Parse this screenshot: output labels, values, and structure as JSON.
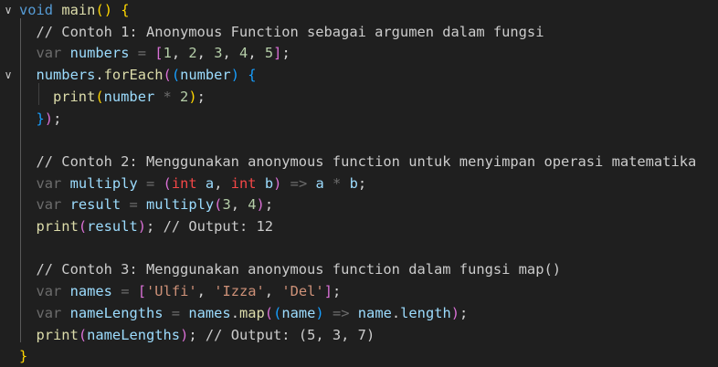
{
  "editor": {
    "lines": [
      {
        "fold": "chevron-down",
        "indent": 0,
        "tokens": [
          {
            "t": "void",
            "c": "t-kw"
          },
          {
            "t": " ",
            "c": ""
          },
          {
            "t": "main",
            "c": "t-fn"
          },
          {
            "t": "()",
            "c": "b-gold"
          },
          {
            "t": " ",
            "c": ""
          },
          {
            "t": "{",
            "c": "b-gold"
          }
        ]
      },
      {
        "fold": "",
        "indent": 1,
        "tokens": [
          {
            "t": "// Contoh 1: Anonymous Function sebagai argumen dalam fungsi",
            "c": "t-cmt"
          }
        ]
      },
      {
        "fold": "",
        "indent": 1,
        "tokens": [
          {
            "t": "var",
            "c": "t-var-kw"
          },
          {
            "t": " ",
            "c": ""
          },
          {
            "t": "numbers",
            "c": "t-var"
          },
          {
            "t": " = ",
            "c": "t-dim"
          },
          {
            "t": "[",
            "c": "b-pink"
          },
          {
            "t": "1",
            "c": "t-num"
          },
          {
            "t": ", ",
            "c": "t-punc"
          },
          {
            "t": "2",
            "c": "t-num"
          },
          {
            "t": ", ",
            "c": "t-punc"
          },
          {
            "t": "3",
            "c": "t-num"
          },
          {
            "t": ", ",
            "c": "t-punc"
          },
          {
            "t": "4",
            "c": "t-num"
          },
          {
            "t": ", ",
            "c": "t-punc"
          },
          {
            "t": "5",
            "c": "t-num"
          },
          {
            "t": "]",
            "c": "b-pink"
          },
          {
            "t": ";",
            "c": "t-punc"
          }
        ]
      },
      {
        "fold": "chevron-down",
        "indent": 1,
        "tokens": [
          {
            "t": "numbers",
            "c": "t-var"
          },
          {
            "t": ".",
            "c": "t-punc"
          },
          {
            "t": "forEach",
            "c": "t-fn"
          },
          {
            "t": "(",
            "c": "b-pink"
          },
          {
            "t": "(",
            "c": "b-blue"
          },
          {
            "t": "number",
            "c": "t-var"
          },
          {
            "t": ")",
            "c": "b-blue"
          },
          {
            "t": " ",
            "c": ""
          },
          {
            "t": "{",
            "c": "b-blue"
          }
        ]
      },
      {
        "fold": "",
        "indent": 2,
        "tokens": [
          {
            "t": "print",
            "c": "t-fn"
          },
          {
            "t": "(",
            "c": "b-gold"
          },
          {
            "t": "number",
            "c": "t-var"
          },
          {
            "t": " * ",
            "c": "t-dim"
          },
          {
            "t": "2",
            "c": "t-num"
          },
          {
            "t": ")",
            "c": "b-gold"
          },
          {
            "t": ";",
            "c": "t-punc"
          }
        ]
      },
      {
        "fold": "",
        "indent": 1,
        "tokens": [
          {
            "t": "}",
            "c": "b-blue"
          },
          {
            "t": ")",
            "c": "b-pink"
          },
          {
            "t": ";",
            "c": "t-punc"
          }
        ]
      },
      {
        "fold": "",
        "indent": 0,
        "tokens": []
      },
      {
        "fold": "",
        "indent": 1,
        "tokens": [
          {
            "t": "// Contoh 2: Menggunakan anonymous function untuk menyimpan operasi matematika",
            "c": "t-cmt"
          }
        ]
      },
      {
        "fold": "",
        "indent": 1,
        "tokens": [
          {
            "t": "var",
            "c": "t-var-kw"
          },
          {
            "t": " ",
            "c": ""
          },
          {
            "t": "multiply",
            "c": "t-var"
          },
          {
            "t": " = ",
            "c": "t-dim"
          },
          {
            "t": "(",
            "c": "b-pink"
          },
          {
            "t": "int",
            "c": "t-type"
          },
          {
            "t": " ",
            "c": ""
          },
          {
            "t": "a",
            "c": "t-var"
          },
          {
            "t": ", ",
            "c": "t-punc"
          },
          {
            "t": "int",
            "c": "t-type"
          },
          {
            "t": " ",
            "c": ""
          },
          {
            "t": "b",
            "c": "t-var"
          },
          {
            "t": ")",
            "c": "b-pink"
          },
          {
            "t": " => ",
            "c": "t-dim"
          },
          {
            "t": "a",
            "c": "t-var"
          },
          {
            "t": " * ",
            "c": "t-dim"
          },
          {
            "t": "b",
            "c": "t-var"
          },
          {
            "t": ";",
            "c": "t-punc"
          }
        ]
      },
      {
        "fold": "",
        "indent": 1,
        "tokens": [
          {
            "t": "var",
            "c": "t-var-kw"
          },
          {
            "t": " ",
            "c": ""
          },
          {
            "t": "result",
            "c": "t-var"
          },
          {
            "t": " = ",
            "c": "t-dim"
          },
          {
            "t": "multiply",
            "c": "t-var"
          },
          {
            "t": "(",
            "c": "b-pink"
          },
          {
            "t": "3",
            "c": "t-num"
          },
          {
            "t": ", ",
            "c": "t-punc"
          },
          {
            "t": "4",
            "c": "t-num"
          },
          {
            "t": ")",
            "c": "b-pink"
          },
          {
            "t": ";",
            "c": "t-punc"
          }
        ]
      },
      {
        "fold": "",
        "indent": 1,
        "tokens": [
          {
            "t": "print",
            "c": "t-fn"
          },
          {
            "t": "(",
            "c": "b-pink"
          },
          {
            "t": "result",
            "c": "t-var"
          },
          {
            "t": ")",
            "c": "b-pink"
          },
          {
            "t": "; ",
            "c": "t-punc"
          },
          {
            "t": "// Output: 12",
            "c": "t-cmt"
          }
        ]
      },
      {
        "fold": "",
        "indent": 0,
        "tokens": []
      },
      {
        "fold": "",
        "indent": 1,
        "tokens": [
          {
            "t": "// Contoh 3: Menggunakan anonymous function dalam fungsi map()",
            "c": "t-cmt"
          }
        ]
      },
      {
        "fold": "",
        "indent": 1,
        "tokens": [
          {
            "t": "var",
            "c": "t-var-kw"
          },
          {
            "t": " ",
            "c": ""
          },
          {
            "t": "names",
            "c": "t-var"
          },
          {
            "t": " = ",
            "c": "t-dim"
          },
          {
            "t": "[",
            "c": "b-pink"
          },
          {
            "t": "'Ulfi'",
            "c": "t-str"
          },
          {
            "t": ", ",
            "c": "t-punc"
          },
          {
            "t": "'Izza'",
            "c": "t-str"
          },
          {
            "t": ", ",
            "c": "t-punc"
          },
          {
            "t": "'Del'",
            "c": "t-str"
          },
          {
            "t": "]",
            "c": "b-pink"
          },
          {
            "t": ";",
            "c": "t-punc"
          }
        ]
      },
      {
        "fold": "",
        "indent": 1,
        "tokens": [
          {
            "t": "var",
            "c": "t-var-kw"
          },
          {
            "t": " ",
            "c": ""
          },
          {
            "t": "nameLengths",
            "c": "t-var"
          },
          {
            "t": " = ",
            "c": "t-dim"
          },
          {
            "t": "names",
            "c": "t-var"
          },
          {
            "t": ".",
            "c": "t-punc"
          },
          {
            "t": "map",
            "c": "t-fn"
          },
          {
            "t": "(",
            "c": "b-pink"
          },
          {
            "t": "(",
            "c": "b-blue"
          },
          {
            "t": "name",
            "c": "t-var"
          },
          {
            "t": ")",
            "c": "b-blue"
          },
          {
            "t": " => ",
            "c": "t-dim"
          },
          {
            "t": "name",
            "c": "t-var"
          },
          {
            "t": ".",
            "c": "t-punc"
          },
          {
            "t": "length",
            "c": "t-var"
          },
          {
            "t": ")",
            "c": "b-pink"
          },
          {
            "t": ";",
            "c": "t-punc"
          }
        ]
      },
      {
        "fold": "",
        "indent": 1,
        "tokens": [
          {
            "t": "print",
            "c": "t-fn"
          },
          {
            "t": "(",
            "c": "b-pink"
          },
          {
            "t": "nameLengths",
            "c": "t-var"
          },
          {
            "t": ")",
            "c": "b-pink"
          },
          {
            "t": "; ",
            "c": "t-punc"
          },
          {
            "t": "// Output: (5, 3, 7)",
            "c": "t-cmt"
          }
        ]
      },
      {
        "fold": "",
        "indent": 0,
        "tokens": [
          {
            "t": "}",
            "c": "b-gold"
          }
        ]
      }
    ]
  }
}
